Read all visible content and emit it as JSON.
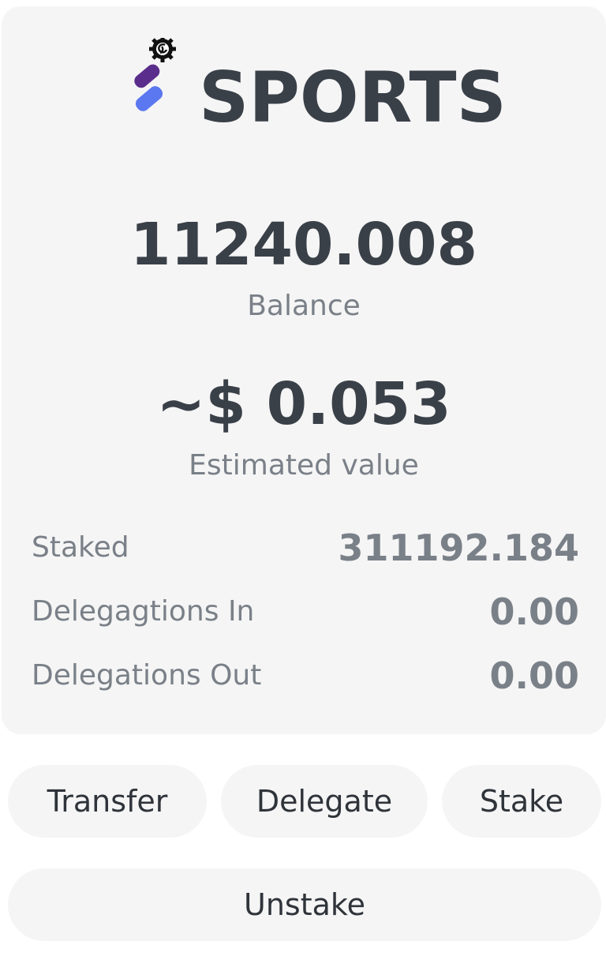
{
  "token": {
    "name": "SPORTS",
    "logo_icon": "sports-token-logo-icon",
    "colors": {
      "logo_purple": "#5a2d8c",
      "logo_blue": "#5b78f0",
      "text_dark": "#3a4048",
      "text_muted": "#7a8088",
      "card_bg": "#f5f5f5"
    }
  },
  "balance": {
    "value": "11240.008",
    "label": "Balance"
  },
  "estimate": {
    "value": "~$ 0.053",
    "label": "Estimated value"
  },
  "stats": [
    {
      "label": "Staked",
      "value": "311192.184"
    },
    {
      "label": "Delegagtions In",
      "value": "0.00"
    },
    {
      "label": "Delegations Out",
      "value": "0.00"
    }
  ],
  "actions": {
    "transfer": "Transfer",
    "delegate": "Delegate",
    "stake": "Stake",
    "unstake": "Unstake"
  }
}
